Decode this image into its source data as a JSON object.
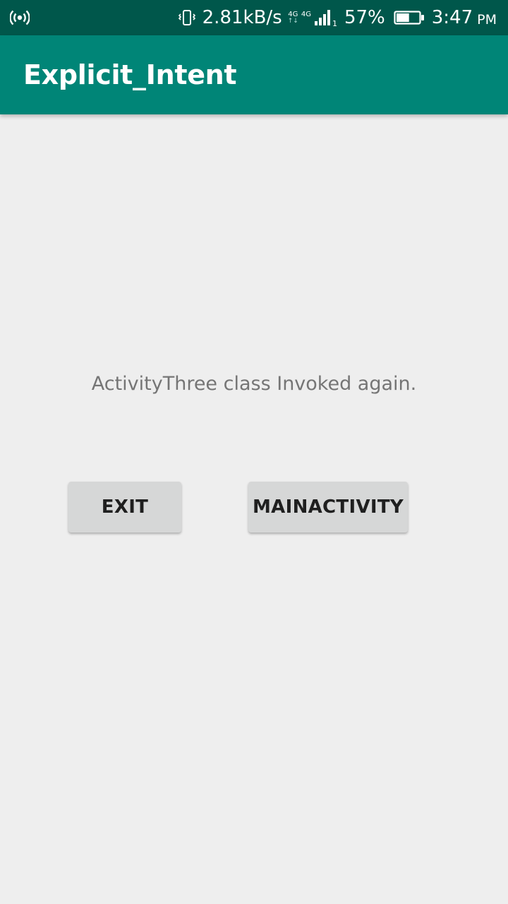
{
  "status_bar": {
    "hotspot_icon": "hotspot-icon",
    "vibrate_icon": "vibrate-icon",
    "network_speed": "2.81kB/s",
    "network_type_1": "4G",
    "network_type_2": "4G",
    "signal_icon": "signal-icon",
    "sim_slot": "1",
    "battery_percent": "57%",
    "battery_icon": "battery-icon",
    "battery_level": 0.57,
    "time": "3:47",
    "ampm": "PM"
  },
  "app_bar": {
    "title": "Explicit_Intent",
    "background_color": "#008577",
    "status_bar_color": "#00574b"
  },
  "main": {
    "message": "ActivityThree class Invoked again.",
    "buttons": {
      "exit_label": "EXIT",
      "main_activity_label": "MAINACTIVITY"
    }
  }
}
